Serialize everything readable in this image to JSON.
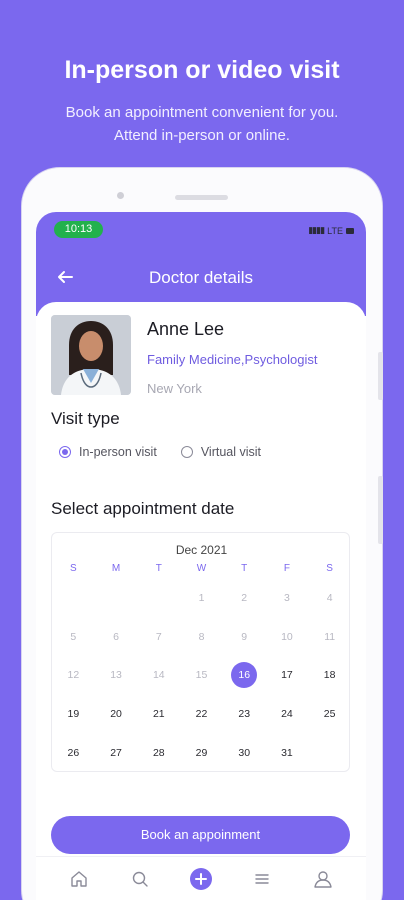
{
  "promo": {
    "title": "In-person or video visit",
    "subtitle_line1": "Book an appointment convenient for you.",
    "subtitle_line2": "Attend in-person or online."
  },
  "status_bar": {
    "time": "10:13",
    "network": "LTE"
  },
  "header": {
    "title": "Doctor details",
    "back_icon": "arrow-left-icon"
  },
  "doctor": {
    "name": "Anne Lee",
    "specialty": "Family Medicine,Psychologist",
    "location": "New York"
  },
  "visit_type": {
    "title": "Visit type",
    "options": [
      {
        "label": "In-person visit",
        "selected": true
      },
      {
        "label": "Virtual visit",
        "selected": false
      }
    ]
  },
  "appointment": {
    "title": "Select appointment date",
    "month": "Dec 2021",
    "weekdays": [
      "S",
      "M",
      "T",
      "W",
      "T",
      "F",
      "S"
    ],
    "selected_day": "16",
    "days": [
      {
        "d": "",
        "muted": true
      },
      {
        "d": "",
        "muted": true
      },
      {
        "d": "",
        "muted": true
      },
      {
        "d": "1",
        "muted": true
      },
      {
        "d": "2",
        "muted": true
      },
      {
        "d": "3",
        "muted": true
      },
      {
        "d": "4",
        "muted": true
      },
      {
        "d": "5",
        "muted": true
      },
      {
        "d": "6",
        "muted": true
      },
      {
        "d": "7",
        "muted": true
      },
      {
        "d": "8",
        "muted": true
      },
      {
        "d": "9",
        "muted": true
      },
      {
        "d": "10",
        "muted": true
      },
      {
        "d": "11",
        "muted": true
      },
      {
        "d": "12",
        "muted": true
      },
      {
        "d": "13",
        "muted": true
      },
      {
        "d": "14",
        "muted": true
      },
      {
        "d": "15",
        "muted": true
      },
      {
        "d": "16",
        "muted": false
      },
      {
        "d": "17",
        "muted": false
      },
      {
        "d": "18",
        "muted": false
      },
      {
        "d": "19",
        "muted": false
      },
      {
        "d": "20",
        "muted": false
      },
      {
        "d": "21",
        "muted": false
      },
      {
        "d": "22",
        "muted": false
      },
      {
        "d": "23",
        "muted": false
      },
      {
        "d": "24",
        "muted": false
      },
      {
        "d": "25",
        "muted": false
      },
      {
        "d": "26",
        "muted": false
      },
      {
        "d": "27",
        "muted": false
      },
      {
        "d": "28",
        "muted": false
      },
      {
        "d": "29",
        "muted": false
      },
      {
        "d": "30",
        "muted": false
      },
      {
        "d": "31",
        "muted": false
      },
      {
        "d": "",
        "muted": true
      }
    ]
  },
  "book_button": {
    "label": "Book an appoinment"
  },
  "tabbar": {
    "items": [
      "home-icon",
      "search-icon",
      "add-icon",
      "menu-icon",
      "profile-icon"
    ]
  },
  "colors": {
    "accent": "#7b68ee",
    "status_green": "#22b14c"
  }
}
